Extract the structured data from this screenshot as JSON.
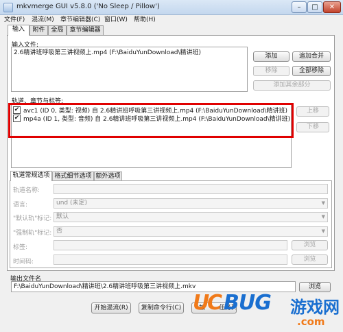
{
  "window": {
    "title": "mkvmerge GUI v5.8.0 ('No Sleep / Pillow')",
    "min": "–",
    "max": "□",
    "close": "✕"
  },
  "menu": [
    "文件(F)",
    "混流(M)",
    "章节编辑器(C)",
    "窗口(W)",
    "帮助(H)"
  ],
  "tabs": [
    "输入",
    "附件",
    "全局",
    "章节编辑器"
  ],
  "input_files": {
    "label": "输入文件:",
    "items": [
      "2.6精讲班呼吸第三讲视频上.mp4 (F:\\BaiduYunDownload\\精讲班)"
    ],
    "buttons": {
      "add": "添加",
      "append": "追加合并",
      "remove": "移除",
      "remove_all": "全部移除",
      "add_parts": "添加其余部分"
    }
  },
  "tracks": {
    "label": "轨道、章节与标签:",
    "items": [
      {
        "checked": "✔",
        "text": "avc1 (ID 0, 类型: 视频) 自 2.6精讲班呼吸第三讲视频上.mp4 (F:\\BaiduYunDownload\\精讲班)"
      },
      {
        "checked": "✔",
        "text": "mp4a (ID 1, 类型: 音频) 自 2.6精讲班呼吸第三讲视频上.mp4 (F:\\BaiduYunDownload\\精讲班)"
      }
    ],
    "buttons": {
      "up": "上移",
      "down": "下移"
    }
  },
  "subtabs": [
    "轨道常规选项",
    "格式细节选项",
    "额外选项"
  ],
  "options": {
    "track_name": "轨道名称:",
    "language": "语言:",
    "language_value": "und (未定)",
    "default_flag": "\"默认轨\"标记:",
    "default_value": "默认",
    "forced_flag": "\"强制轨\"标记:",
    "forced_value": "否",
    "tags": "标签:",
    "timecodes": "时间码:",
    "browse": "浏览"
  },
  "output": {
    "label": "输出文件名",
    "value": "F:\\BaiduYunDownload\\精讲班\\2.6精讲班呼吸第三讲视频上.mkv",
    "browse": "浏览"
  },
  "actions": {
    "start": "开始混流(R)",
    "copy": "复制命令行(C)",
    "queue_fragment": "加",
    "queue_fragment2": "任务列"
  },
  "watermark": {
    "u": "U",
    "c": "C",
    "bug": "BUG",
    "cn": "游戏网",
    "dotcom": ".com"
  },
  "colors": {
    "highlight": "#e00000",
    "wm_orange": "#f07a1a",
    "wm_blue": "#1a6fd0"
  }
}
